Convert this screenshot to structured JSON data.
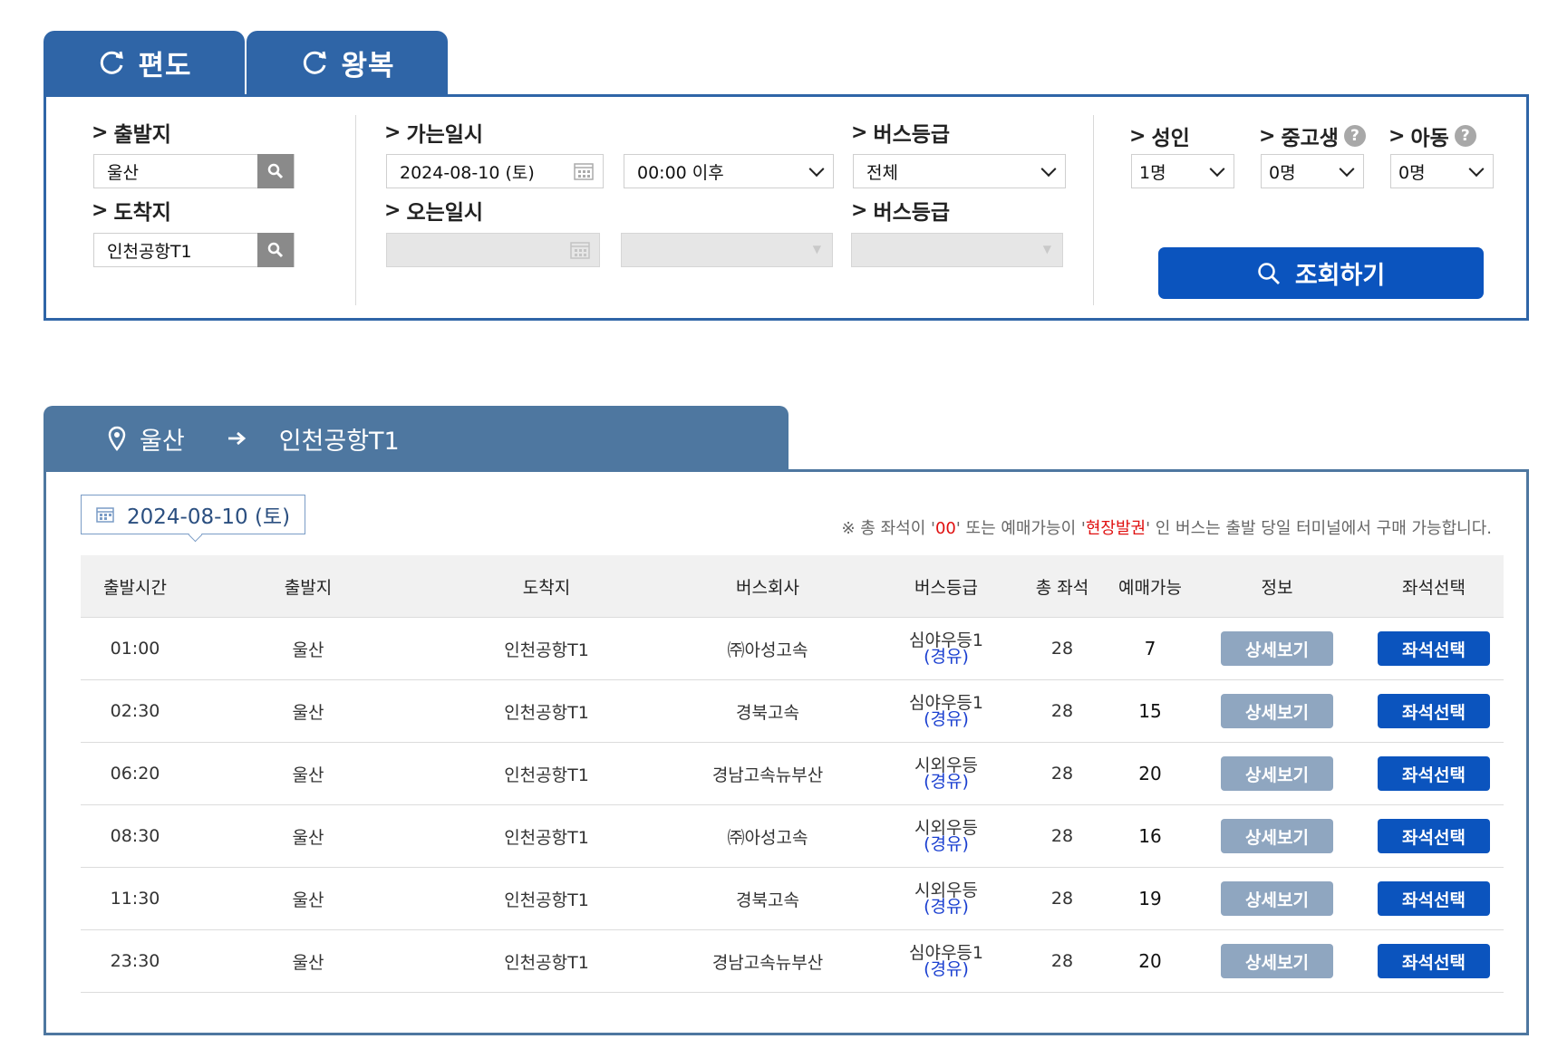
{
  "trip_tabs": {
    "oneway": "편도",
    "round": "왕복"
  },
  "search": {
    "departure_label": "출발지",
    "departure_value": "울산",
    "arrival_label": "도착지",
    "arrival_value": "인천공항T1",
    "go_date_label": "가는일시",
    "go_date_value": "2024-08-10 (토)",
    "go_time_value": "00:00 이후",
    "go_grade_label": "버스등급",
    "go_grade_value": "전체",
    "return_date_label": "오는일시",
    "return_grade_label": "버스등급",
    "adult_label": "성인",
    "adult_value": "1명",
    "student_label": "중고생",
    "student_value": "0명",
    "child_label": "아동",
    "child_value": "0명",
    "help_glyph": "?",
    "submit_label": "조회하기"
  },
  "route": {
    "from": "울산",
    "to": "인천공항T1"
  },
  "result": {
    "date_chip": "2024-08-10 (토)",
    "notice_prefix": "※ 총 좌석이 '",
    "notice_zero": "00",
    "notice_mid": "' 또는 예매가능이 '",
    "notice_onsite": "현장발권",
    "notice_suffix": "' 인 버스는 출발 당일 터미널에서 구매 가능합니다."
  },
  "table": {
    "headers": [
      "출발시간",
      "출발지",
      "도착지",
      "버스회사",
      "버스등급",
      "총 좌석",
      "예매가능",
      "정보",
      "좌석선택"
    ],
    "rows": [
      {
        "time": "01:00",
        "from": "울산",
        "to": "인천공항T1",
        "company": "㈜아성고속",
        "grade": "심야우등1",
        "via": "(경유)",
        "total": "28",
        "avail": "7",
        "detail": "상세보기",
        "seat": "좌석선택"
      },
      {
        "time": "02:30",
        "from": "울산",
        "to": "인천공항T1",
        "company": "경북고속",
        "grade": "심야우등1",
        "via": "(경유)",
        "total": "28",
        "avail": "15",
        "detail": "상세보기",
        "seat": "좌석선택"
      },
      {
        "time": "06:20",
        "from": "울산",
        "to": "인천공항T1",
        "company": "경남고속뉴부산",
        "grade": "시외우등",
        "via": "(경유)",
        "total": "28",
        "avail": "20",
        "detail": "상세보기",
        "seat": "좌석선택"
      },
      {
        "time": "08:30",
        "from": "울산",
        "to": "인천공항T1",
        "company": "㈜아성고속",
        "grade": "시외우등",
        "via": "(경유)",
        "total": "28",
        "avail": "16",
        "detail": "상세보기",
        "seat": "좌석선택"
      },
      {
        "time": "11:30",
        "from": "울산",
        "to": "인천공항T1",
        "company": "경북고속",
        "grade": "시외우등",
        "via": "(경유)",
        "total": "28",
        "avail": "19",
        "detail": "상세보기",
        "seat": "좌석선택"
      },
      {
        "time": "23:30",
        "from": "울산",
        "to": "인천공항T1",
        "company": "경남고속뉴부산",
        "grade": "심야우등1",
        "via": "(경유)",
        "total": "28",
        "avail": "20",
        "detail": "상세보기",
        "seat": "좌석선택"
      }
    ]
  },
  "colors": {
    "tab_blue": "#2f65a7",
    "route_blue": "#4e77a0",
    "primary_button": "#0b54be",
    "detail_button": "#8fa6c0",
    "notice_red": "#e01010",
    "via_blue": "#1a3fd0"
  }
}
